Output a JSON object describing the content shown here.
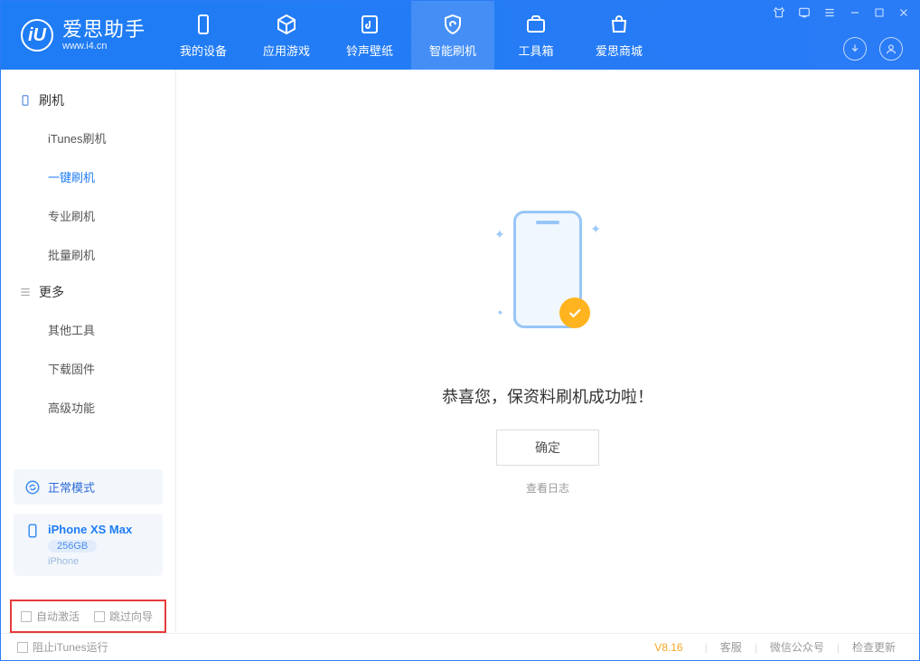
{
  "app": {
    "title": "爱思助手",
    "url": "www.i4.cn",
    "logo_letter": "iU"
  },
  "tabs": [
    {
      "label": "我的设备"
    },
    {
      "label": "应用游戏"
    },
    {
      "label": "铃声壁纸"
    },
    {
      "label": "智能刷机"
    },
    {
      "label": "工具箱"
    },
    {
      "label": "爱思商城"
    }
  ],
  "sidebar": {
    "section1_head": "刷机",
    "items1": [
      "iTunes刷机",
      "一键刷机",
      "专业刷机",
      "批量刷机"
    ],
    "section2_head": "更多",
    "items2": [
      "其他工具",
      "下载固件",
      "高级功能"
    ]
  },
  "mode": {
    "label": "正常模式"
  },
  "device": {
    "name": "iPhone XS Max",
    "capacity": "256GB",
    "type": "iPhone"
  },
  "checkboxes": {
    "auto_activate": "自动激活",
    "skip_guide": "跳过向导"
  },
  "main": {
    "success_msg": "恭喜您，保资料刷机成功啦！",
    "ok_btn": "确定",
    "log_link": "查看日志"
  },
  "footer": {
    "stop_itunes": "阻止iTunes运行",
    "version": "V8.16",
    "links": [
      "客服",
      "微信公众号",
      "检查更新"
    ]
  }
}
